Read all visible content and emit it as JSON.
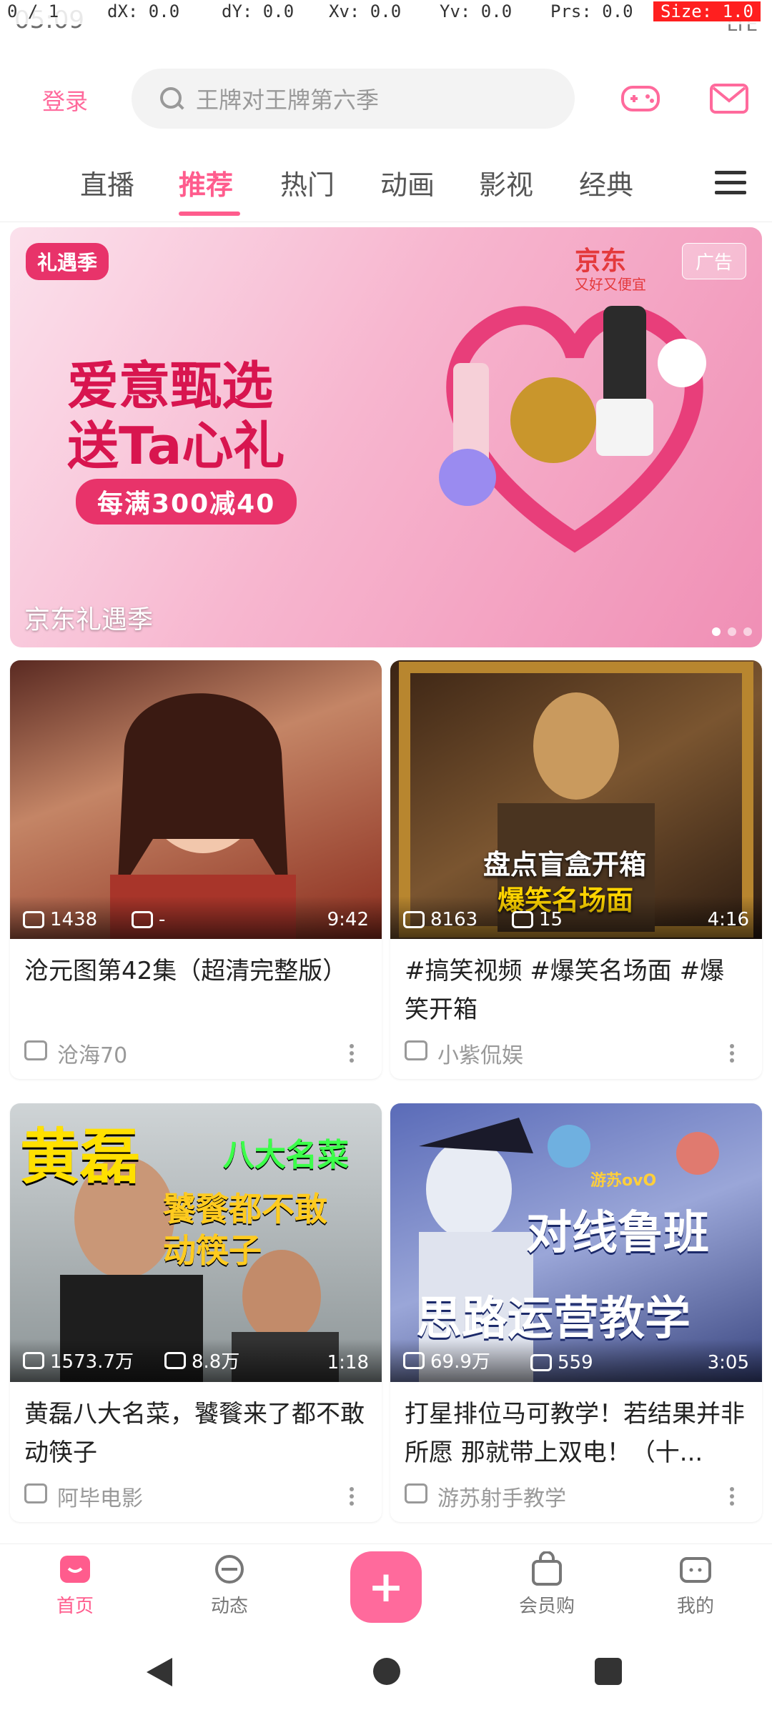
{
  "status": {
    "time": "05:09",
    "signal": "LTE"
  },
  "debug": {
    "pointer": "0 / 1",
    "dx": "dX: 0.0",
    "dy": "dY: 0.0",
    "xv": "Xv: 0.0",
    "yv": "Yv: 0.0",
    "prs": "Prs: 0.0",
    "size": "Size: 1.0"
  },
  "header": {
    "login_label": "登录",
    "search_placeholder": "王牌对王牌第六季",
    "search_icon": "search-icon",
    "game_icon": "gamepad-icon",
    "message_icon": "mail-icon"
  },
  "tabs": [
    {
      "label": "直播"
    },
    {
      "label": "推荐",
      "active": true
    },
    {
      "label": "热门"
    },
    {
      "label": "动画"
    },
    {
      "label": "影视"
    },
    {
      "label": "经典"
    }
  ],
  "banner": {
    "brand": "礼遇季",
    "jd": "京东",
    "jd_sub": "又好又便宜",
    "ad": "广告",
    "headline1": "爱意甄选",
    "headline2": "送Ta心礼",
    "pill": "每满300减40",
    "title": "京东礼遇季"
  },
  "cards": [
    {
      "views": "1438",
      "danmaku": "-",
      "duration": "9:42",
      "title": "沧元图第42集（超清完整版）",
      "uploader": "沧海70"
    },
    {
      "views": "8163",
      "danmaku": "15",
      "duration": "4:16",
      "title": "#搞笑视频 #爆笑名场面 #爆笑开箱",
      "uploader": "小紫侃娱",
      "overlay1": "盘点盲盒开箱",
      "overlay2": "爆笑名场面"
    },
    {
      "views": "1573.7万",
      "danmaku": "8.8万",
      "duration": "1:18",
      "title": "黄磊八大名菜，饕餮来了都不敢动筷子",
      "uploader": "阿毕电影",
      "overlay1": "黄磊",
      "overlay2": "八大名菜",
      "overlay3": "饕餮都不敢",
      "overlay4": "动筷子"
    },
    {
      "views": "69.9万",
      "danmaku": "559",
      "duration": "3:05",
      "title": "打星排位马可教学！若结果并非所愿 那就带上双电！（十...",
      "uploader": "游苏射手教学",
      "overlay1": "对线鲁班",
      "overlay2": "思路运营教学",
      "overlay3": "游苏ovO"
    }
  ],
  "bottom_nav": [
    {
      "label": "首页",
      "icon": "home-face-icon",
      "active": true
    },
    {
      "label": "动态",
      "icon": "dynamic-icon"
    },
    {
      "label": "",
      "icon": "plus-icon"
    },
    {
      "label": "会员购",
      "icon": "shopping-bag-icon"
    },
    {
      "label": "我的",
      "icon": "profile-tv-icon"
    }
  ],
  "colors": {
    "accent": "#ff5c8d",
    "banner": "#f7b6cf"
  }
}
